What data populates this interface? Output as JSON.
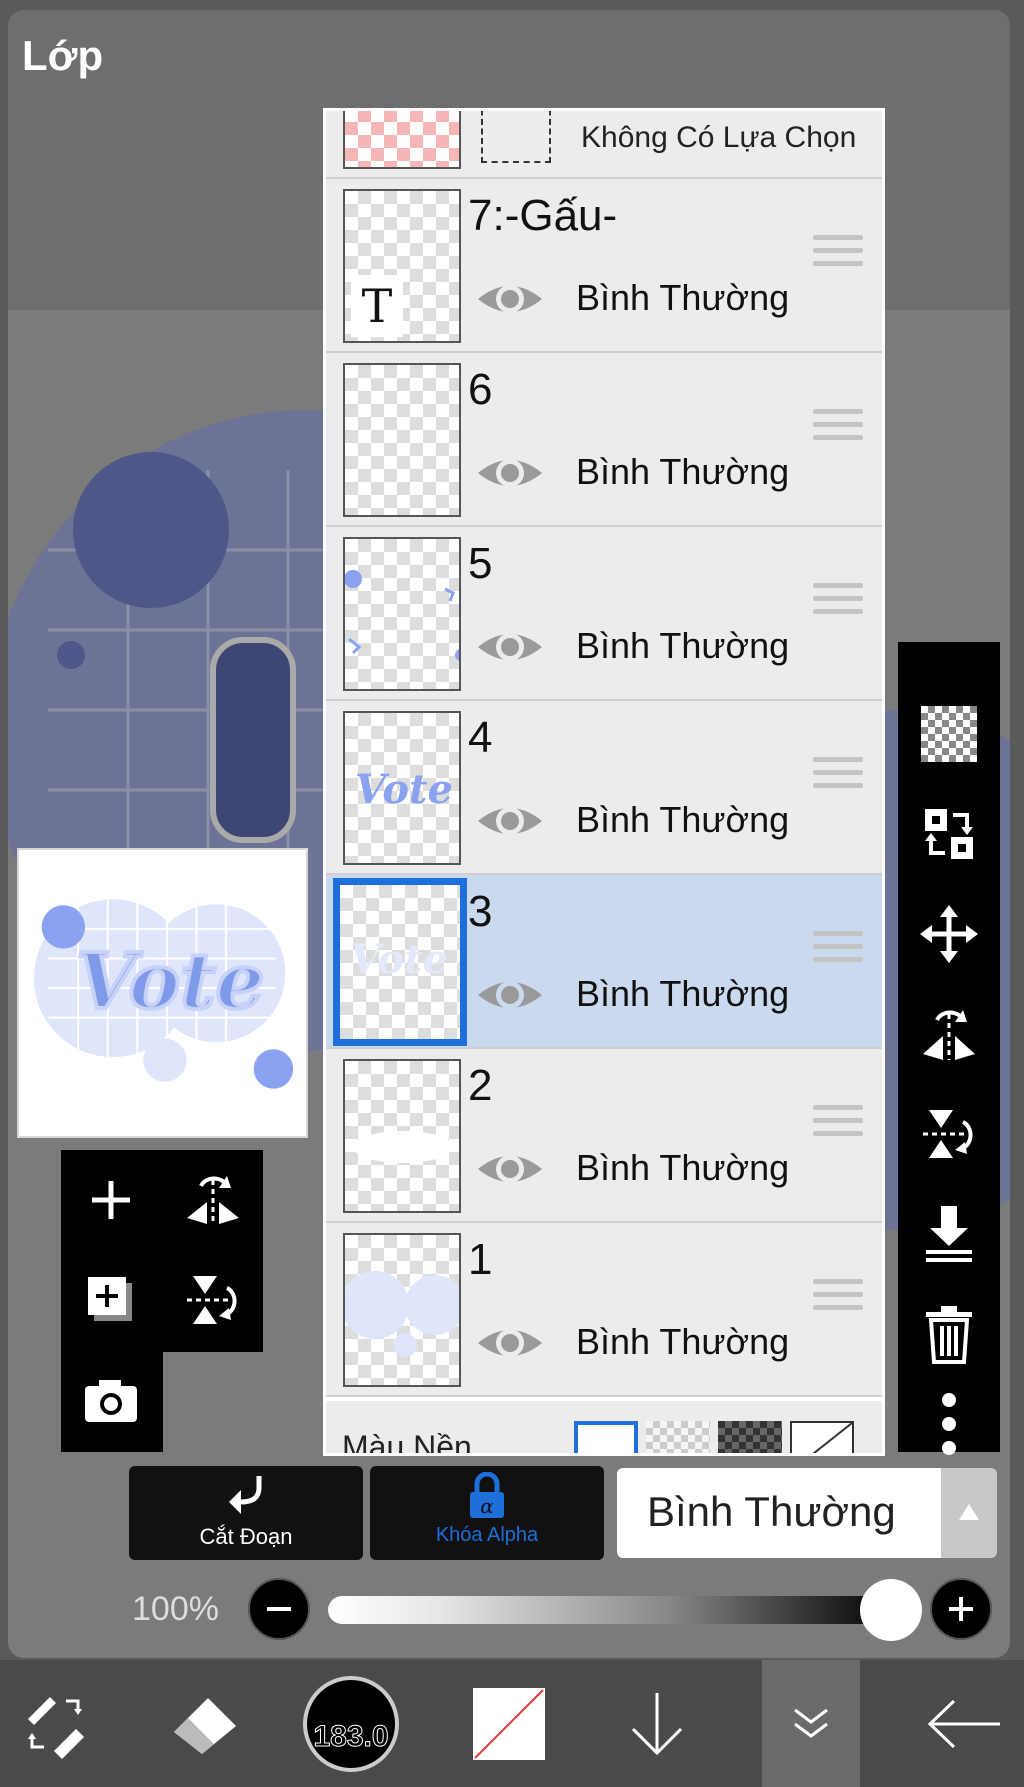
{
  "panel": {
    "title": "Lớp"
  },
  "layers": {
    "no_selection_label": "Không Có Lựa Chọn",
    "items": [
      {
        "name": "7:-Gấu-",
        "mode": "Bình Thường",
        "type": "text",
        "selected": false
      },
      {
        "name": "6",
        "mode": "Bình Thường",
        "selected": false
      },
      {
        "name": "5",
        "mode": "Bình Thường",
        "selected": false
      },
      {
        "name": "4",
        "mode": "Bình Thường",
        "selected": false
      },
      {
        "name": "3",
        "mode": "Bình Thường",
        "selected": true
      },
      {
        "name": "2",
        "mode": "Bình Thường",
        "selected": false
      },
      {
        "name": "1",
        "mode": "Bình Thường",
        "selected": false
      }
    ],
    "background_color_label": "Màu Nền"
  },
  "controls": {
    "clip_label": "Cắt Đoạn",
    "alpha_lock_label": "Khóa Alpha",
    "blend_mode": "Bình Thường",
    "opacity": "100%",
    "opacity_value": 1.0
  },
  "navbar": {
    "brush_size": "183.0"
  },
  "preview": {
    "art_text": "Vote"
  },
  "colors": {
    "selection": "#1e6fd9",
    "selected_row": "#cbd9ee",
    "art_blue": "#7f9ae8",
    "alpha_lock": "#1e6fd9"
  }
}
